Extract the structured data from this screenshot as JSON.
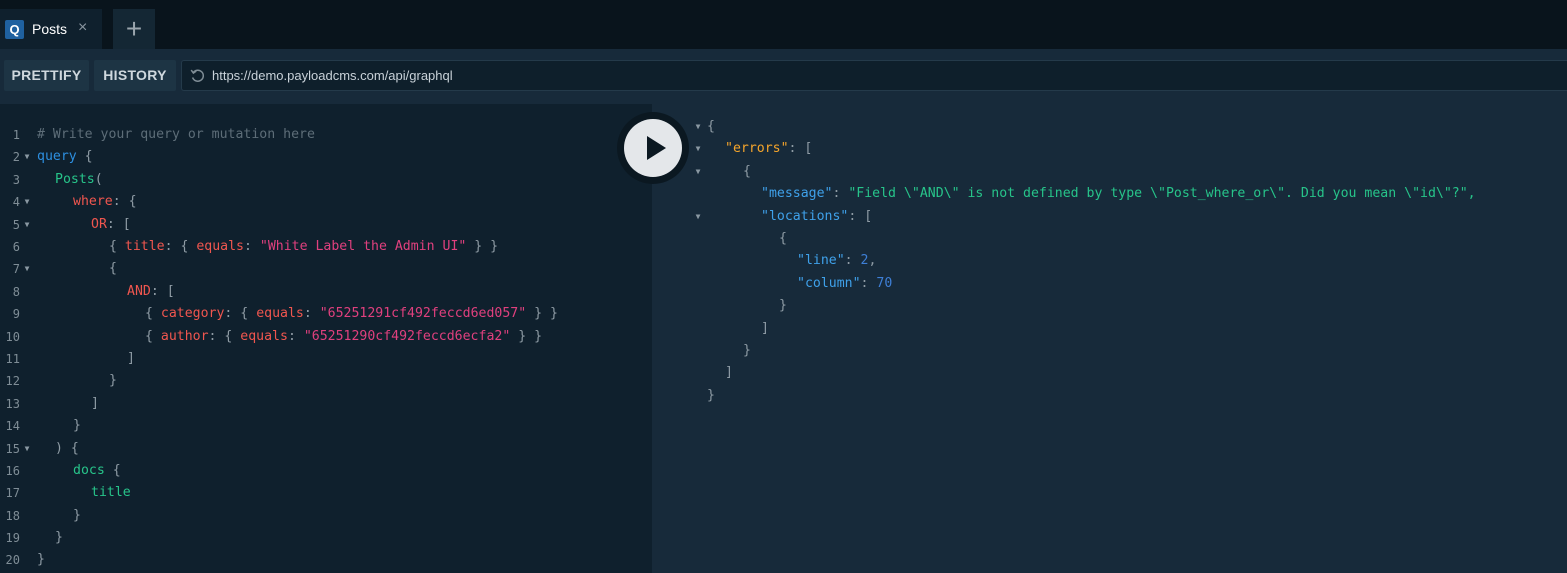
{
  "tab": {
    "badge": "Q",
    "title": "Posts",
    "close_icon": "×",
    "add_icon": "+"
  },
  "toolbar": {
    "prettify": "PRETTIFY",
    "history": "HISTORY",
    "url": "https://demo.payloadcms.com/api/graphql"
  },
  "editor": {
    "line_numbers": [
      "1",
      "2",
      "3",
      "4",
      "5",
      "6",
      "7",
      "8",
      "9",
      "10",
      "11",
      "12",
      "13",
      "14",
      "15",
      "16",
      "17",
      "18",
      "19",
      "20"
    ],
    "comment": "# Write your query or mutation here",
    "query_kw": "query",
    "Posts": "Posts",
    "where": "where",
    "or_key": "OR",
    "title": "title",
    "equals": "equals",
    "title_value": "\"White Label the Admin UI\"",
    "and_key": "AND",
    "category": "category",
    "category_value": "\"65251291cf492feccd6ed057\"",
    "author": "author",
    "author_value": "\"65251290cf492feccd6ecfa2\"",
    "docs": "docs"
  },
  "result": {
    "errors_key": "\"errors\"",
    "message_key": "\"message\"",
    "message_value": "\"Field \\\"AND\\\" is not defined by type \\\"Post_where_or\\\". Did you mean \\\"id\\\"?\",",
    "locations_key": "\"locations\"",
    "line_key": "\"line\"",
    "line_value": "2",
    "column_key": "\"column\"",
    "column_value": "70"
  },
  "colors": {
    "background": "#0f202d",
    "toolbar": "#172a3a",
    "accent": "#1f61a0"
  }
}
